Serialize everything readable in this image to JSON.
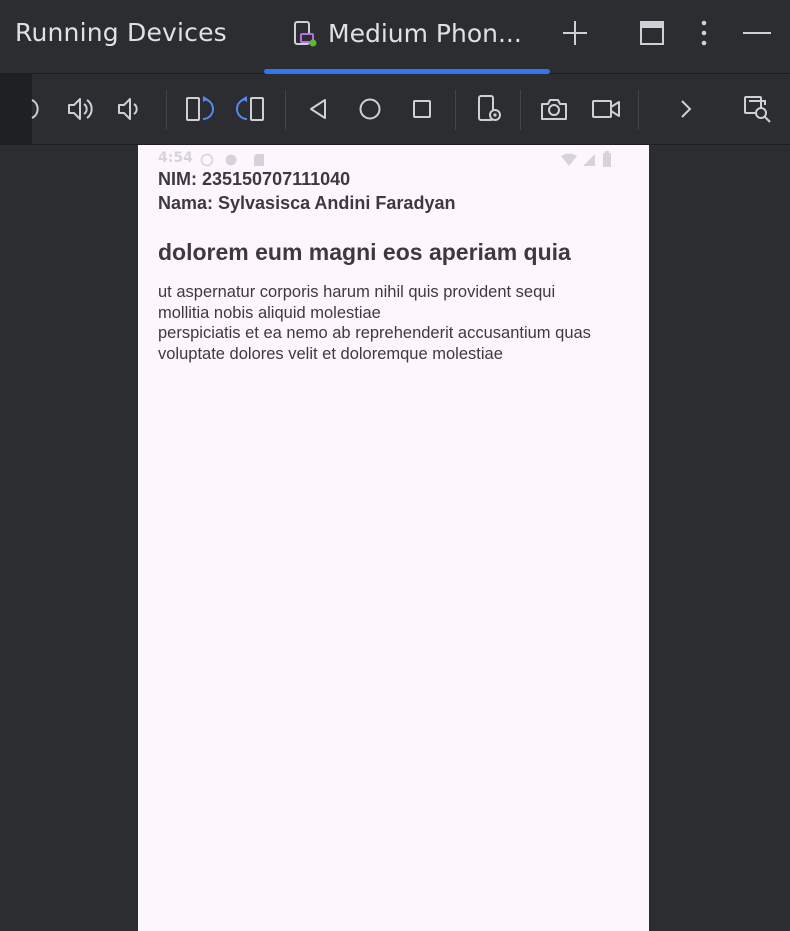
{
  "header": {
    "title": "Running Devices",
    "tab_label": "Medium Phon...",
    "add_icon": "plus-icon",
    "window_icon": "window-icon",
    "more_icon": "more-vertical-icon",
    "minimize_icon": "minimize-icon"
  },
  "toolbar": {
    "icons": [
      "power-icon",
      "volume-up-icon",
      "volume-down-icon",
      "rotate-left-icon",
      "rotate-right-icon",
      "back-icon",
      "home-icon",
      "overview-icon",
      "device-settings-icon",
      "screenshot-icon",
      "screen-record-icon",
      "more-chevron-icon",
      "zoom-icon"
    ]
  },
  "device": {
    "status_time": "4:54",
    "nim": "NIM: 235150707111040",
    "nama": "Nama: Sylvasisca Andini Faradyan",
    "post_title": "dolorem eum magni eos aperiam quia",
    "post_body": "ut aspernatur corporis harum nihil quis provident sequi\nmollitia nobis aliquid molestiae\nperspiciatis et ea nemo ab reprehenderit accusantium quas\nvoluptate dolores velit et doloremque molestiae"
  },
  "colors": {
    "accent": "#3574f0",
    "background": "#2b2d30",
    "device_bg": "#fdf7fd",
    "text": "#dfe1e5"
  }
}
